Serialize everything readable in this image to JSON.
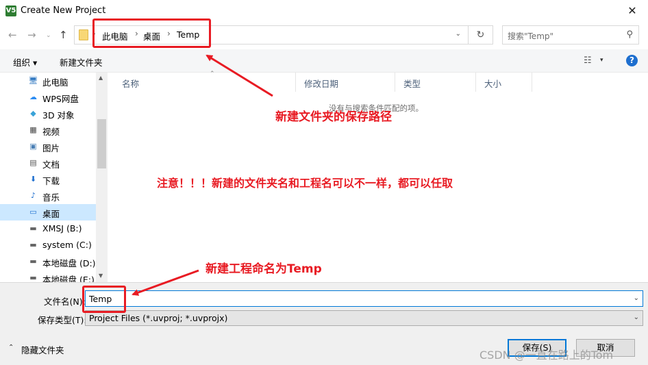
{
  "window": {
    "title": "Create New Project",
    "app_icon": "V5",
    "close_glyph": "✕"
  },
  "nav": {
    "back_glyph": "←",
    "forward_glyph": "→",
    "recent_glyph": "⌄",
    "up_glyph": "↑",
    "refresh_glyph": "↻"
  },
  "address": {
    "crumbs": [
      "此电脑",
      "桌面",
      "Temp"
    ],
    "sep": "›",
    "drop": "⌄"
  },
  "search": {
    "placeholder": "搜索\"Temp\"",
    "icon": "search-icon"
  },
  "toolbar": {
    "organize": "组织 ▾",
    "new_folder": "新建文件夹",
    "view_glyph": "☷",
    "view_drop": "▾",
    "help": "?"
  },
  "sidebar": {
    "items": [
      {
        "label": "此电脑",
        "icon": "🖥"
      },
      {
        "label": "WPS网盘",
        "icon": "☁"
      },
      {
        "label": "3D 对象",
        "icon": "◆"
      },
      {
        "label": "视频",
        "icon": "▦"
      },
      {
        "label": "图片",
        "icon": "▣"
      },
      {
        "label": "文档",
        "icon": "▤"
      },
      {
        "label": "下载",
        "icon": "⬇"
      },
      {
        "label": "音乐",
        "icon": "♪"
      },
      {
        "label": "桌面",
        "icon": "▭"
      },
      {
        "label": "XMSJ (B:)",
        "icon": "▬"
      },
      {
        "label": "system (C:)",
        "icon": "▬"
      },
      {
        "label": "本地磁盘 (D:)",
        "icon": "▬"
      },
      {
        "label": "本地磁盘 (E:)",
        "icon": "▬"
      }
    ],
    "selected_index": 8,
    "scroll_up": "▲",
    "scroll_down": "▼"
  },
  "columns": [
    "名称",
    "修改日期",
    "类型",
    "大小"
  ],
  "sort_glyph": "⌃",
  "empty_message": "没有与搜索条件匹配的项。",
  "filename": {
    "label": "文件名(N):",
    "value": "Temp",
    "drop": "⌄"
  },
  "filetype": {
    "label": "保存类型(T):",
    "value": "Project Files (*.uvproj; *.uvprojx)",
    "drop": "⌄"
  },
  "hide_folders": {
    "chevron": "⌃",
    "label": "隐藏文件夹"
  },
  "buttons": {
    "save": "保存(S)",
    "cancel": "取消"
  },
  "annotations": {
    "path_note": "新建文件夹的保存路径",
    "warning_note": "注意！！！新建的文件夹名和工程名可以不一样，都可以任取",
    "name_note": "新建工程命名为Temp",
    "color": "#e81b23"
  },
  "watermark": "CSDN @一直在路上的Tom"
}
